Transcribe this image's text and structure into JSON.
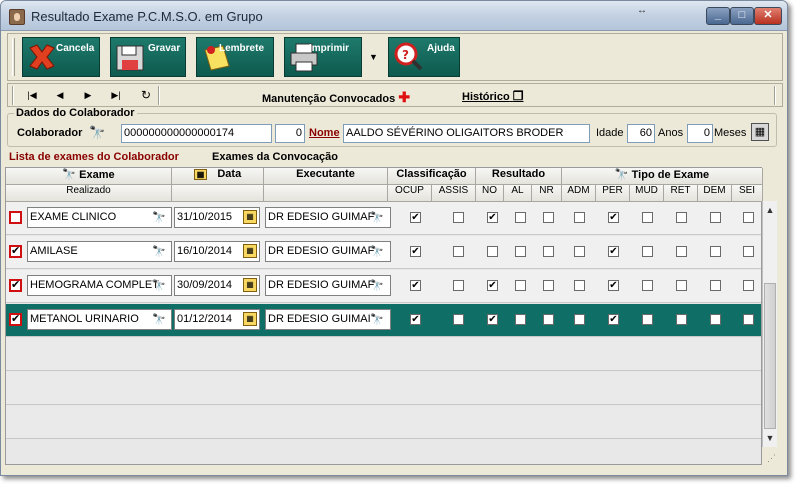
{
  "window": {
    "title": "Resultado Exame P.C.M.S.O. em Grupo",
    "resize_glyph": "↔"
  },
  "toolbar": {
    "buttons": [
      {
        "label": "Cancela",
        "icon": "cancel-x-icon"
      },
      {
        "label": "Gravar",
        "icon": "floppy-disk-icon"
      },
      {
        "label": "Lembrete",
        "icon": "sticky-note-icon"
      },
      {
        "label": "Imprimir",
        "icon": "printer-icon"
      },
      {
        "label": "Ajuda",
        "icon": "help-magnifier-icon"
      }
    ],
    "dropdown_glyph": "▼"
  },
  "navbar": {
    "first": "|◀",
    "prev": "◀",
    "next": "▶",
    "last": "▶|",
    "refresh": "↻",
    "manutencao": "Manutenção Convocados",
    "historico": "Histórico"
  },
  "colaborador": {
    "group_title": "Dados do Colaborador",
    "label": "Colaborador",
    "matricula": "000000000000000174",
    "codigo": "0",
    "nome_label": "Nome",
    "nome": "AALDO SÉVÉRINO OLIGAITORS BRODER",
    "idade_label": "Idade",
    "idade": "60",
    "anos_label": "Anos",
    "meses": "0",
    "meses_label": "Meses"
  },
  "tabs": {
    "lista": "Lista de exames do Colaborador",
    "convocacao": "Exames da Convocação"
  },
  "grid": {
    "headers": {
      "exame": "Exame",
      "data": "Data",
      "executante": "Executante",
      "classificacao": "Classificação",
      "resultado": "Resultado",
      "tipo_exame": "Tipo de Exame",
      "realizado": "Realizado",
      "ocup": "OCUP",
      "assis": "ASSIS",
      "no": "NO",
      "al": "AL",
      "nr": "NR",
      "adm": "ADM",
      "per": "PER",
      "mud": "MUD",
      "ret": "RET",
      "dem": "DEM",
      "sei": "SEI"
    },
    "rows": [
      {
        "realizado": false,
        "exame": "EXAME CLINICO",
        "data": "31/10/2015",
        "executante": "DR EDESIO GUIMAF",
        "ocup": true,
        "assis": false,
        "no": true,
        "al": false,
        "nr": false,
        "adm": false,
        "per": true,
        "mud": false,
        "ret": false,
        "dem": false,
        "sei": false
      },
      {
        "realizado": true,
        "exame": "AMILASE",
        "data": "16/10/2014",
        "executante": "DR EDESIO GUIMAF",
        "ocup": true,
        "assis": false,
        "no": false,
        "al": false,
        "nr": false,
        "adm": false,
        "per": true,
        "mud": false,
        "ret": false,
        "dem": false,
        "sei": false
      },
      {
        "realizado": true,
        "exame": "HEMOGRAMA COMPLET",
        "data": "30/09/2014",
        "executante": "DR EDESIO GUIMAF",
        "ocup": true,
        "assis": false,
        "no": true,
        "al": false,
        "nr": false,
        "adm": false,
        "per": true,
        "mud": false,
        "ret": false,
        "dem": false,
        "sei": false
      },
      {
        "realizado": true,
        "exame": "METANOL URINARIO",
        "data": "01/12/2014",
        "executante": "DR EDESIO GUIMAI",
        "ocup": true,
        "assis": false,
        "no": true,
        "al": false,
        "nr": false,
        "adm": false,
        "per": true,
        "mud": false,
        "ret": false,
        "dem": false,
        "sei": false
      }
    ],
    "selected_row": 3
  },
  "colors": {
    "selected_row": "#0f6f66",
    "toolbar_btn": "#1e7a6c",
    "required_red": "#d01010",
    "tab_active": "#8a0000"
  }
}
